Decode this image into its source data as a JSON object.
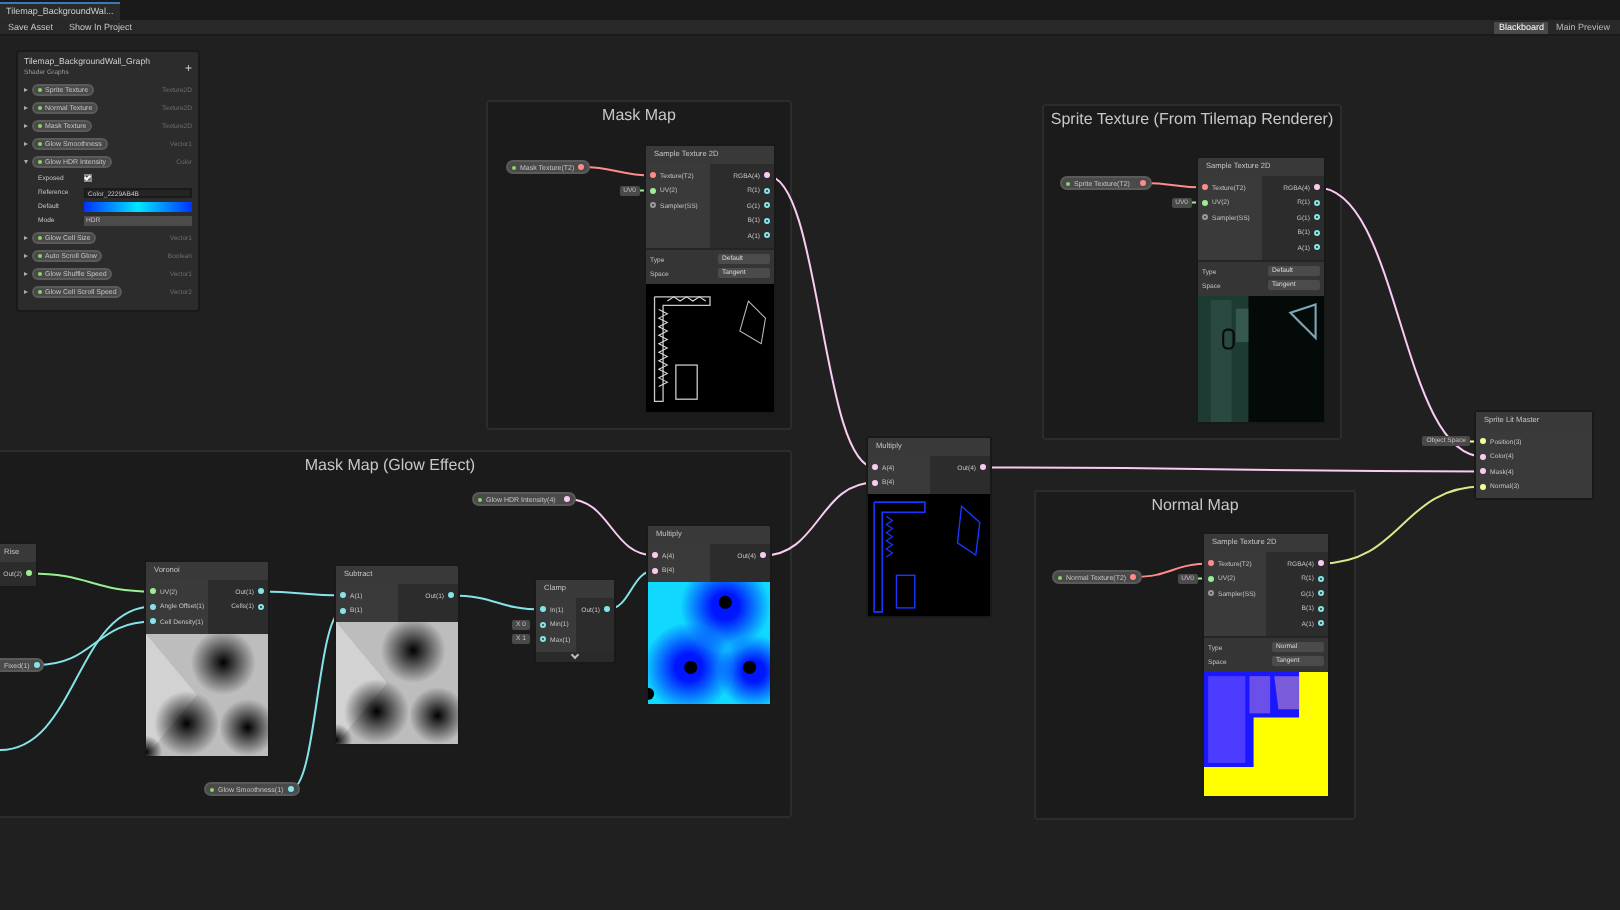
{
  "tab": {
    "title": "Tilemap_BackgroundWal..."
  },
  "toolbar": {
    "left": [
      {
        "label": "Save Asset"
      },
      {
        "label": "Show In Project"
      }
    ],
    "right": [
      {
        "label": "Blackboard",
        "selected": true
      },
      {
        "label": "Main Preview",
        "selected": false
      }
    ]
  },
  "blackboard": {
    "title": "Tilemap_BackgroundWall_Graph",
    "subtitle": "Shader Graphs",
    "add_button": "+",
    "properties": [
      {
        "name": "Sprite Texture",
        "type": "Texture2D",
        "expanded": false
      },
      {
        "name": "Normal Texture",
        "type": "Texture2D",
        "expanded": false
      },
      {
        "name": "Mask Texture",
        "type": "Texture2D",
        "expanded": false
      },
      {
        "name": "Glow Smoothness",
        "type": "Vector1",
        "expanded": false
      },
      {
        "name": "Glow HDR Intensity",
        "type": "Color",
        "expanded": true,
        "fields": [
          {
            "kind": "checkbox",
            "label": "Exposed",
            "checked": true
          },
          {
            "kind": "text",
            "label": "Reference",
            "value": "Color_2229AB4B"
          },
          {
            "kind": "color",
            "label": "Default"
          },
          {
            "kind": "dropdown",
            "label": "Mode",
            "value": "HDR"
          }
        ]
      },
      {
        "name": "Glow Cell Size",
        "type": "Vector1",
        "expanded": false
      },
      {
        "name": "Auto Scroll Glow",
        "type": "Boolean",
        "expanded": false
      },
      {
        "name": "Glow Shuffle Speed",
        "type": "Vector1",
        "expanded": false
      },
      {
        "name": "Glow Cell Scroll Speed",
        "type": "Vector2",
        "expanded": false
      }
    ]
  },
  "groups": [
    {
      "title": "Mask Map"
    },
    {
      "title": "Sprite Texture (From Tilemap Renderer)"
    },
    {
      "title": "Normal Map"
    },
    {
      "title": "Mask Map (Glow Effect)"
    }
  ],
  "property_nodes": [
    {
      "label": "Mask Texture(T2)",
      "color": "#ff8b8b"
    },
    {
      "label": "Sprite Texture(T2)",
      "color": "#ff8b8b"
    },
    {
      "label": "Normal Texture(T2)",
      "color": "#ff8b8b"
    },
    {
      "label": "Glow HDR Intensity(4)",
      "color": "#fbcbf4"
    },
    {
      "label": "Glow Smoothness(1)",
      "color": "#84e4e7"
    },
    {
      "label": "Fixed(1)",
      "color": "#84e4e7"
    }
  ],
  "nodes": [
    {
      "title": "Sample Texture 2D",
      "inputs": [
        {
          "label": "Texture(T2)",
          "color": "#ff8b8b",
          "connected": true
        },
        {
          "label": "UV(2)",
          "color": "#9aef92",
          "connected": true,
          "default": "UV0"
        },
        {
          "label": "Sampler(SS)",
          "color": "#9a9a9a",
          "connected": false
        }
      ],
      "outputs": [
        {
          "label": "RGBA(4)",
          "color": "#fbcbf4",
          "connected": true
        },
        {
          "label": "R(1)",
          "color": "#84e4e7",
          "connected": false
        },
        {
          "label": "G(1)",
          "color": "#84e4e7",
          "connected": false
        },
        {
          "label": "B(1)",
          "color": "#84e4e7",
          "connected": false
        },
        {
          "label": "A(1)",
          "color": "#84e4e7",
          "connected": false
        }
      ],
      "fields": [
        {
          "label": "Type",
          "value": "Default"
        },
        {
          "label": "Space",
          "value": "Tangent"
        }
      ],
      "kind": "mask"
    },
    {
      "title": "Sample Texture 2D",
      "inputs": [
        {
          "label": "Texture(T2)",
          "color": "#ff8b8b",
          "connected": true
        },
        {
          "label": "UV(2)",
          "color": "#9aef92",
          "connected": true,
          "default": "UV0"
        },
        {
          "label": "Sampler(SS)",
          "color": "#9a9a9a",
          "connected": false
        }
      ],
      "outputs": [
        {
          "label": "RGBA(4)",
          "color": "#fbcbf4",
          "connected": true
        },
        {
          "label": "R(1)",
          "color": "#84e4e7",
          "connected": false
        },
        {
          "label": "G(1)",
          "color": "#84e4e7",
          "connected": false
        },
        {
          "label": "B(1)",
          "color": "#84e4e7",
          "connected": false
        },
        {
          "label": "A(1)",
          "color": "#84e4e7",
          "connected": false
        }
      ],
      "fields": [
        {
          "label": "Type",
          "value": "Default"
        },
        {
          "label": "Space",
          "value": "Tangent"
        }
      ],
      "kind": "sprite"
    },
    {
      "title": "Multiply",
      "inputs": [
        {
          "label": "A(4)",
          "color": "#fbcbf4",
          "connected": true
        },
        {
          "label": "B(4)",
          "color": "#fbcbf4",
          "connected": true
        }
      ],
      "outputs": [
        {
          "label": "Out(4)",
          "color": "#fbcbf4",
          "connected": true
        }
      ],
      "kind": "multiply"
    },
    {
      "title": "Sprite Lit Master",
      "inputs": [
        {
          "label": "Position(3)",
          "color": "#f6ff9a",
          "connected": true,
          "default": "Object Space"
        },
        {
          "label": "Color(4)",
          "color": "#fbcbf4",
          "connected": true
        },
        {
          "label": "Mask(4)",
          "color": "#fbcbf4",
          "connected": true
        },
        {
          "label": "Normal(3)",
          "color": "#f6ff9a",
          "connected": true
        }
      ],
      "kind": "master"
    },
    {
      "title": "Sample Texture 2D",
      "inputs": [
        {
          "label": "Texture(T2)",
          "color": "#ff8b8b",
          "connected": true
        },
        {
          "label": "UV(2)",
          "color": "#9aef92",
          "connected": true,
          "default": "UV0"
        },
        {
          "label": "Sampler(SS)",
          "color": "#9a9a9a",
          "connected": false
        }
      ],
      "outputs": [
        {
          "label": "RGBA(4)",
          "color": "#fbcbf4",
          "connected": true
        },
        {
          "label": "R(1)",
          "color": "#84e4e7",
          "connected": false
        },
        {
          "label": "G(1)",
          "color": "#84e4e7",
          "connected": false
        },
        {
          "label": "B(1)",
          "color": "#84e4e7",
          "connected": false
        },
        {
          "label": "A(1)",
          "color": "#84e4e7",
          "connected": false
        }
      ],
      "fields": [
        {
          "label": "Type",
          "value": "Normal"
        },
        {
          "label": "Space",
          "value": "Tangent"
        }
      ],
      "kind": "normal"
    },
    {
      "title": "Rise",
      "kind": "plain",
      "outputs": [
        {
          "label": "Out(2)",
          "color": "#9aef92",
          "connected": true
        }
      ]
    },
    {
      "title": "Voronoi",
      "inputs": [
        {
          "label": "UV(2)",
          "color": "#9aef92",
          "connected": true
        },
        {
          "label": "Angle Offset(1)",
          "color": "#84e4e7",
          "connected": true
        },
        {
          "label": "Cell Density(1)",
          "color": "#84e4e7",
          "connected": true
        }
      ],
      "outputs": [
        {
          "label": "Out(1)",
          "color": "#84e4e7",
          "connected": true
        },
        {
          "label": "Cells(1)",
          "color": "#84e4e7",
          "connected": false
        }
      ],
      "kind": "voronoi"
    },
    {
      "title": "Subtract",
      "inputs": [
        {
          "label": "A(1)",
          "color": "#84e4e7",
          "connected": true
        },
        {
          "label": "B(1)",
          "color": "#84e4e7",
          "connected": true
        }
      ],
      "outputs": [
        {
          "label": "Out(1)",
          "color": "#84e4e7",
          "connected": true
        }
      ],
      "kind": "voronoi"
    },
    {
      "title": "Clamp",
      "inputs": [
        {
          "label": "In(1)",
          "color": "#84e4e7",
          "connected": true
        },
        {
          "label": "Min(1)",
          "color": "#84e4e7",
          "connected": false,
          "default": "X 0"
        },
        {
          "label": "Max(1)",
          "color": "#84e4e7",
          "connected": false,
          "default": "X 1"
        }
      ],
      "outputs": [
        {
          "label": "Out(1)",
          "color": "#84e4e7",
          "connected": true
        }
      ],
      "kind": "plain",
      "collapsible": true
    },
    {
      "title": "Multiply",
      "inputs": [
        {
          "label": "A(4)",
          "color": "#fbcbf4",
          "connected": true
        },
        {
          "label": "B(4)",
          "color": "#fbcbf4",
          "connected": true
        }
      ],
      "outputs": [
        {
          "label": "Out(4)",
          "color": "#fbcbf4",
          "connected": true
        }
      ],
      "kind": "glow"
    }
  ]
}
